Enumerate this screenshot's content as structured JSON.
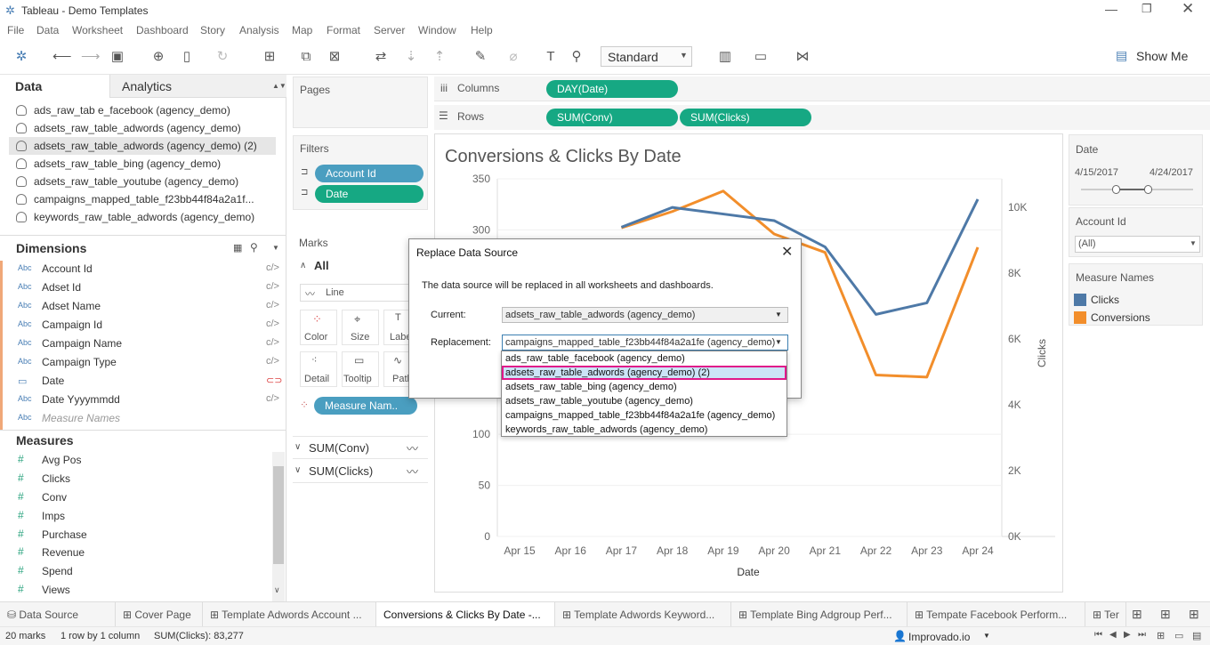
{
  "window": {
    "title": "Tableau - Demo Templates"
  },
  "menu": [
    "File",
    "Data",
    "Worksheet",
    "Dashboard",
    "Story",
    "Analysis",
    "Map",
    "Format",
    "Server",
    "Window",
    "Help"
  ],
  "toolbar": {
    "fit_select": "Standard",
    "show_me": "Show Me"
  },
  "left": {
    "tab_data": "Data",
    "tab_analytics": "Analytics",
    "datasources": [
      "ads_raw_tab e_facebook (agency_demo)",
      "adsets_raw_table_adwords (agency_demo)",
      "adsets_raw_table_adwords (agency_demo) (2)",
      "adsets_raw_table_bing (agency_demo)",
      "adsets_raw_table_youtube (agency_demo)",
      "campaigns_mapped_table_f23bb44f84a2a1f...",
      "keywords_raw_table_adwords (agency_demo)"
    ],
    "dimensions_title": "Dimensions",
    "dimensions": [
      {
        "type": "Abc",
        "name": "Account Id"
      },
      {
        "type": "Abc",
        "name": "Adset Id"
      },
      {
        "type": "Abc",
        "name": "Adset Name"
      },
      {
        "type": "Abc",
        "name": "Campaign Id"
      },
      {
        "type": "Abc",
        "name": "Campaign Name"
      },
      {
        "type": "Abc",
        "name": "Campaign Type"
      },
      {
        "type": "▭",
        "name": "Date"
      },
      {
        "type": "Abc",
        "name": "Date Yyyymmdd"
      },
      {
        "type": "Abc",
        "name": "Measure Names"
      }
    ],
    "measures_title": "Measures",
    "measures": [
      "Avg Pos",
      "Clicks",
      "Conv",
      "Imps",
      "Purchase",
      "Revenue",
      "Spend",
      "Views"
    ]
  },
  "mid": {
    "pages_label": "Pages",
    "filters_label": "Filters",
    "filters": [
      "Account Id",
      "Date"
    ],
    "marks_label": "Marks",
    "marks_all": "All",
    "mark_type": "Line",
    "mark_buttons": [
      "Color",
      "Size",
      "Label",
      "Detail",
      "Tooltip",
      "Path"
    ],
    "measure_pill": "Measure Nam..",
    "sum_conv": "SUM(Conv)",
    "sum_clicks": "SUM(Clicks)"
  },
  "shelves": {
    "columns_label": "Columns",
    "rows_label": "Rows",
    "column_pill": "DAY(Date)",
    "row_pills": [
      "SUM(Conv)",
      "SUM(Clicks)"
    ]
  },
  "chart_title": "Conversions & Clicks By Date",
  "chart_data": {
    "type": "line",
    "title": "Conversions & Clicks By Date",
    "xlabel": "Date",
    "categories": [
      "Apr 15",
      "Apr 16",
      "Apr 17",
      "Apr 18",
      "Apr 19",
      "Apr 20",
      "Apr 21",
      "Apr 22",
      "Apr 23",
      "Apr 24"
    ],
    "left_axis": {
      "label": "",
      "ticks": [
        "350",
        "300",
        "100",
        "50",
        "0"
      ],
      "ylim": [
        0,
        350
      ]
    },
    "right_axis": {
      "label": "Clicks",
      "ticks": [
        "10K",
        "8K",
        "6K",
        "4K",
        "2K",
        "0K"
      ],
      "ylim": [
        0,
        10000
      ]
    },
    "series": [
      {
        "name": "Conversions",
        "axis": "left",
        "color": "#f28e2b",
        "values": [
          null,
          null,
          302,
          318,
          338,
          296,
          278,
          158,
          156,
          283
        ]
      },
      {
        "name": "Clicks",
        "axis": "right",
        "color": "#4e79a7",
        "values": [
          null,
          null,
          9400,
          10000,
          9800,
          9600,
          8800,
          6750,
          7100,
          10250
        ]
      }
    ]
  },
  "right": {
    "date_title": "Date",
    "date_start": "4/15/2017",
    "date_end": "4/24/2017",
    "account_title": "Account Id",
    "account_value": "(All)",
    "legend_title": "Measure Names",
    "legend": [
      {
        "label": "Clicks",
        "color": "#4e79a7"
      },
      {
        "label": "Conversions",
        "color": "#f28e2b"
      }
    ]
  },
  "dialog": {
    "title": "Replace Data Source",
    "message": "The data source will be replaced in all worksheets and dashboards.",
    "current_label": "Current:",
    "current_value": "adsets_raw_table_adwords (agency_demo)",
    "replacement_label": "Replacement:",
    "replacement_value": "campaigns_mapped_table_f23bb44f84a2a1fe (agency_demo)",
    "options": [
      "ads_raw_table_facebook (agency_demo)",
      "adsets_raw_table_adwords (agency_demo) (2)",
      "adsets_raw_table_bing (agency_demo)",
      "adsets_raw_table_youtube (agency_demo)",
      "campaigns_mapped_table_f23bb44f84a2a1fe (agency_demo)",
      "keywords_raw_table_adwords (agency_demo)"
    ],
    "highlight_color": "#e0198a"
  },
  "tabs": [
    "Data Source",
    "Cover Page",
    "Template Adwords Account ...",
    "Conversions & Clicks By Date -...",
    "Template Adwords Keyword...",
    "Template Bing Adgroup Perf...",
    "Tempate Facebook Perform...",
    "Ter"
  ],
  "status": {
    "marks": "20 marks",
    "rows": "1 row by 1 column",
    "sum": "SUM(Clicks): 83,277",
    "user": "Improvado.io"
  }
}
